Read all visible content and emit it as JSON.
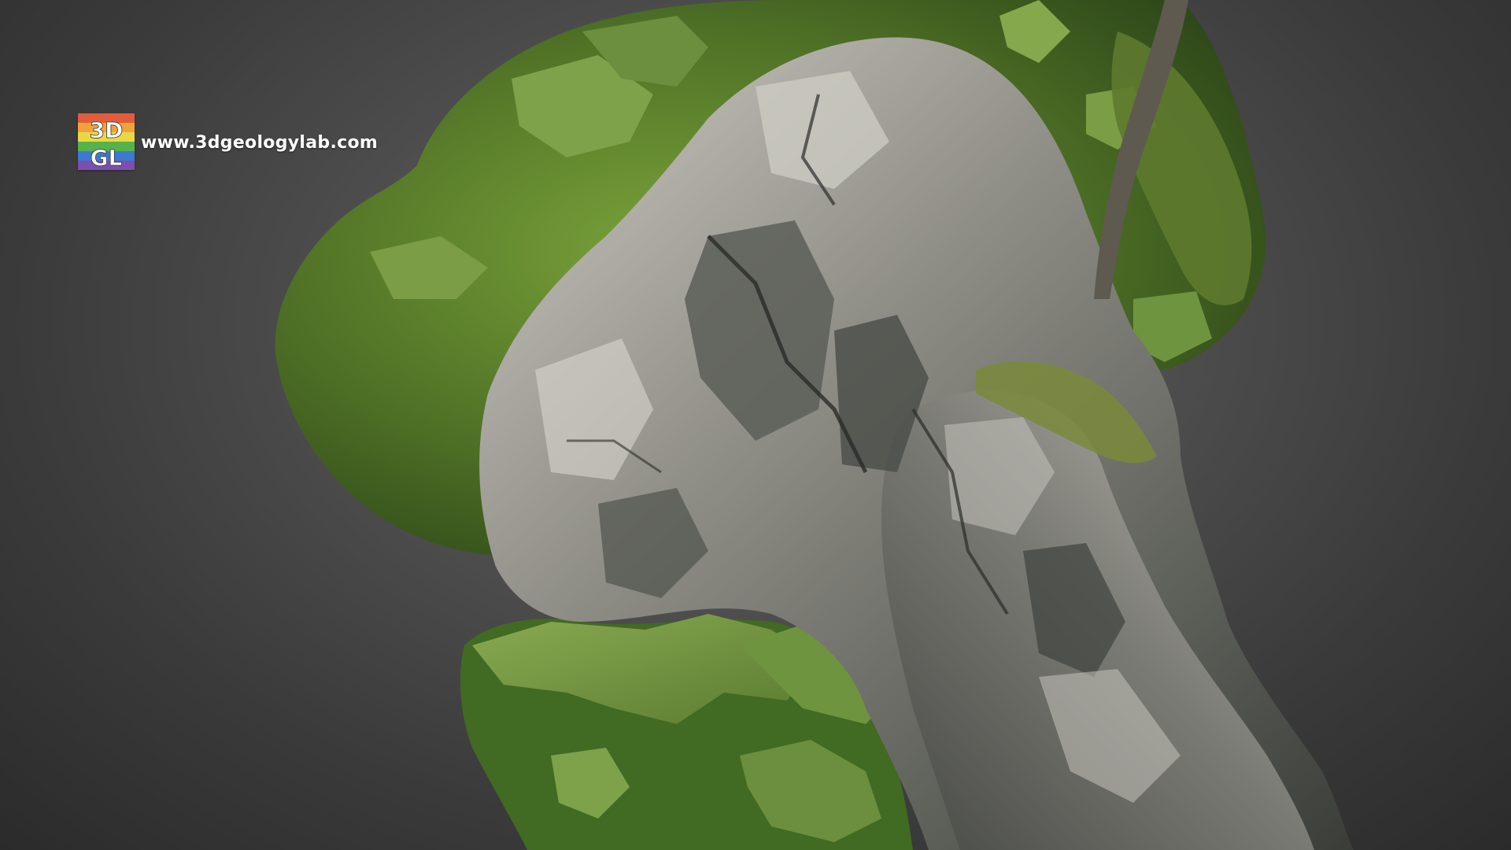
{
  "watermark": {
    "logo_text_top": "3D",
    "logo_text_bottom": "GL",
    "url": "www.3dgeologylab.com"
  },
  "scene": {
    "subject": "rock-outcrop-3d-model",
    "colors": {
      "background_center": "#6a6a6a",
      "background_edge": "#2b2b2b",
      "moss_dark": "#2f4a1c",
      "moss_mid": "#5a7f2c",
      "moss_light": "#8fb04a",
      "leaf_flat": "#6b8f3e",
      "rock_light": "#b9b8b0",
      "rock_mid": "#7c7c76",
      "rock_dark": "#3e403c"
    }
  }
}
